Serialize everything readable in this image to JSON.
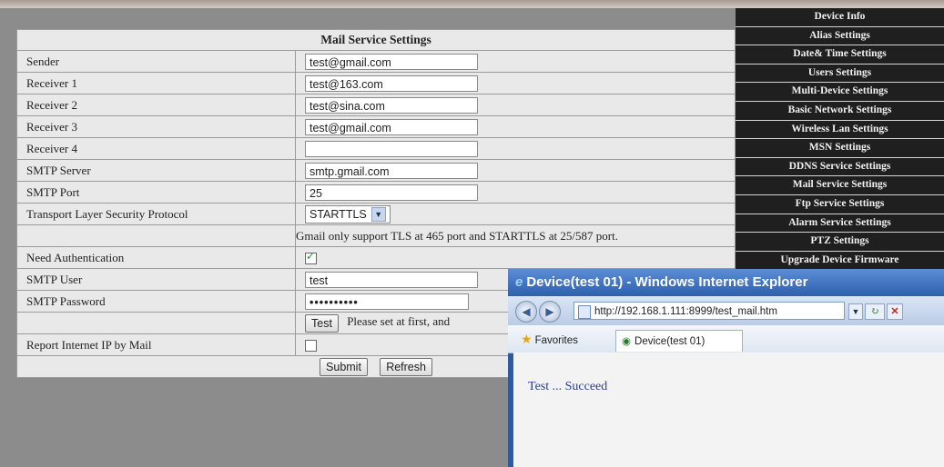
{
  "form": {
    "title": "Mail Service Settings",
    "sender_label": "Sender",
    "sender_value": "test@gmail.com",
    "receiver1_label": "Receiver 1",
    "receiver1_value": "test@163.com",
    "receiver2_label": "Receiver 2",
    "receiver2_value": "test@sina.com",
    "receiver3_label": "Receiver 3",
    "receiver3_value": "test@gmail.com",
    "receiver4_label": "Receiver 4",
    "receiver4_value": "",
    "smtp_server_label": "SMTP Server",
    "smtp_server_value": "smtp.gmail.com",
    "smtp_port_label": "SMTP Port",
    "smtp_port_value": "25",
    "tls_label": "Transport Layer Security Protocol",
    "tls_value": "STARTTLS",
    "tls_note": "Gmail only support TLS at 465 port and STARTTLS at 25/587 port.",
    "need_auth_label": "Need Authentication",
    "need_auth_checked": true,
    "smtp_user_label": "SMTP User",
    "smtp_user_value": "test",
    "smtp_password_label": "SMTP Password",
    "smtp_password_value": "••••••••••",
    "test_button": "Test",
    "test_hint": "Please set at first, and",
    "report_ip_label": "Report Internet IP by Mail",
    "report_ip_checked": false,
    "submit_button": "Submit",
    "refresh_button": "Refresh"
  },
  "sidebar": {
    "items": [
      "Device Info",
      "Alias Settings",
      "Date& Time Settings",
      "Users Settings",
      "Multi-Device Settings",
      "Basic Network Settings",
      "Wireless Lan Settings",
      "MSN Settings",
      "DDNS Service Settings",
      "Mail Service Settings",
      "Ftp Service Settings",
      "Alarm Service Settings",
      "PTZ Settings",
      "Upgrade Device Firmware"
    ]
  },
  "ie_window": {
    "title": "Device(test 01) - Windows Internet Explorer",
    "address": "http://192.168.1.111:8999/test_mail.htm",
    "favorites_label": "Favorites",
    "tab_label": "Device(test 01)",
    "content_text": "Test ... Succeed"
  }
}
